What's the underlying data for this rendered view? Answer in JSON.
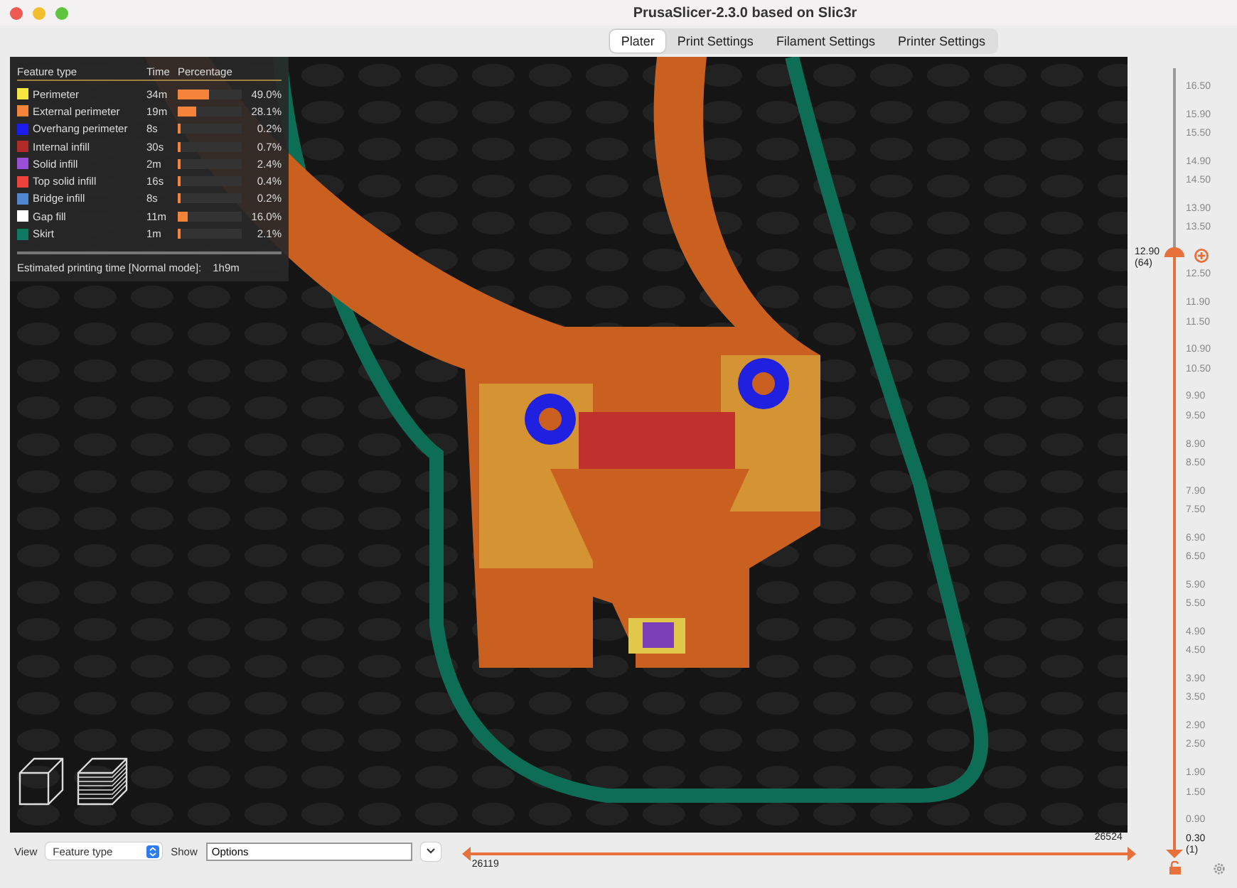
{
  "window": {
    "title": "PrusaSlicer-2.3.0 based on Slic3r"
  },
  "tabs": [
    {
      "label": "Plater",
      "selected": true
    },
    {
      "label": "Print Settings",
      "selected": false
    },
    {
      "label": "Filament Settings",
      "selected": false
    },
    {
      "label": "Printer Settings",
      "selected": false
    }
  ],
  "legend": {
    "columns": [
      "Feature type",
      "Time",
      "Percentage"
    ],
    "rows": [
      {
        "name": "Perimeter",
        "color": "#f5e642",
        "time": "34m",
        "level": 0.49,
        "percentage": "49.0%"
      },
      {
        "name": "External perimeter",
        "color": "#f5833a",
        "time": "19m",
        "level": 0.281,
        "percentage": "28.1%"
      },
      {
        "name": "Overhang perimeter",
        "color": "#1c1cf0",
        "time": "8s",
        "level": 0.002,
        "percentage": "0.2%"
      },
      {
        "name": "Internal infill",
        "color": "#b02a28",
        "time": "30s",
        "level": 0.007,
        "percentage": "0.7%"
      },
      {
        "name": "Solid infill",
        "color": "#9a4fd8",
        "time": "2m",
        "level": 0.024,
        "percentage": "2.4%"
      },
      {
        "name": "Top solid infill",
        "color": "#f0413a",
        "time": "16s",
        "level": 0.004,
        "percentage": "0.4%"
      },
      {
        "name": "Bridge infill",
        "color": "#4f86d0",
        "time": "8s",
        "level": 0.002,
        "percentage": "0.2%"
      },
      {
        "name": "Gap fill",
        "color": "#ffffff",
        "time": "11m",
        "level": 0.16,
        "percentage": "16.0%"
      },
      {
        "name": "Skirt",
        "color": "#0f7a5f",
        "time": "1m",
        "level": 0.021,
        "percentage": "2.1%"
      }
    ],
    "estimate_label": "Estimated printing time [Normal mode]:",
    "estimate_value": "1h9m"
  },
  "layer_slider": {
    "ticks": [
      "16.50",
      "15.90",
      "15.50",
      "14.90",
      "14.50",
      "13.90",
      "13.50",
      "12.50",
      "11.90",
      "11.50",
      "10.90",
      "10.50",
      "9.90",
      "9.50",
      "8.90",
      "8.50",
      "7.90",
      "7.50",
      "6.90",
      "6.50",
      "5.90",
      "5.50",
      "4.90",
      "4.50",
      "3.90",
      "3.50",
      "2.90",
      "2.50",
      "1.90",
      "1.50",
      "0.90"
    ],
    "upper": {
      "value": "12.90",
      "layer": "(64)",
      "level": 0.76
    },
    "lower": {
      "value": "0.30",
      "layer": "(1)",
      "level": 0.0
    }
  },
  "bottom_bar": {
    "view_label": "View",
    "view_value": "Feature type",
    "show_label": "Show",
    "show_value": "Options"
  },
  "move_slider": {
    "upper": {
      "value": "26524",
      "level": 1.0
    },
    "lower": {
      "value": "26119",
      "level": 0.0
    }
  }
}
